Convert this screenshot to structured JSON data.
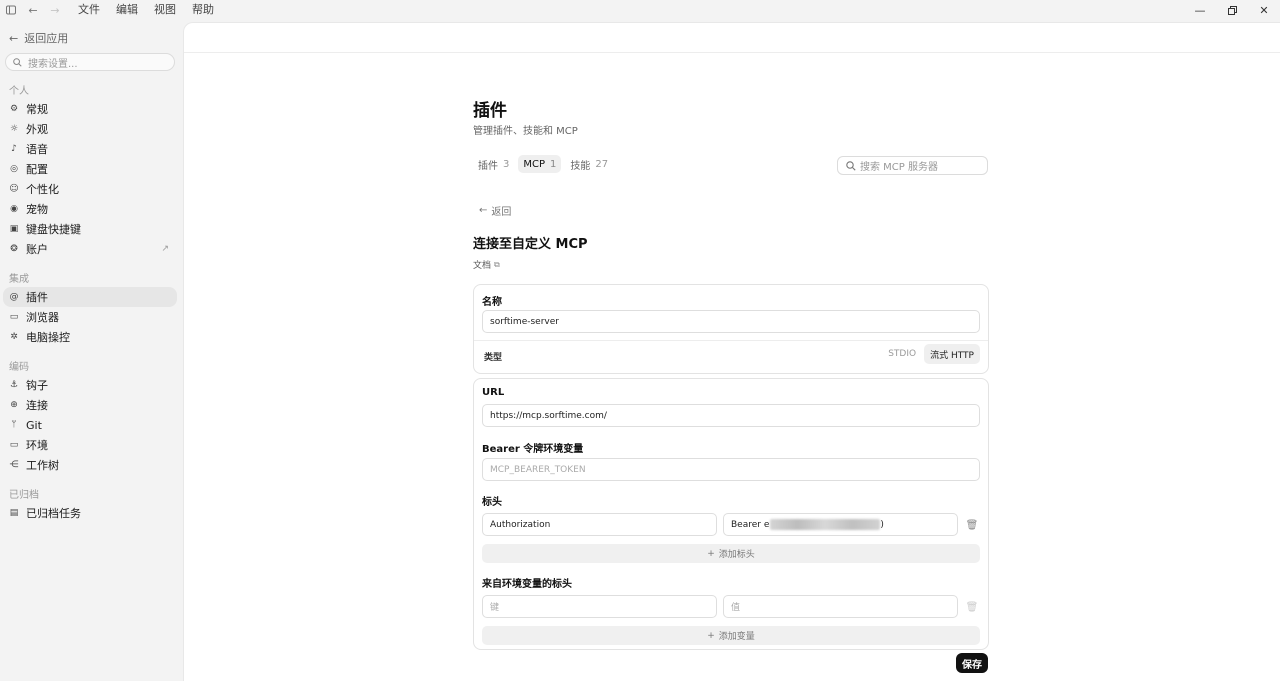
{
  "menubar": {
    "items": [
      "文件",
      "编辑",
      "视图",
      "帮助"
    ]
  },
  "sidebar": {
    "back_label": "返回应用",
    "search_placeholder": "搜索设置...",
    "sections": [
      {
        "label": "个人",
        "items": [
          {
            "label": "常规",
            "icon": "gear-icon"
          },
          {
            "label": "外观",
            "icon": "sun-icon"
          },
          {
            "label": "语音",
            "icon": "microphone-icon"
          },
          {
            "label": "配置",
            "icon": "sliders-icon"
          },
          {
            "label": "个性化",
            "icon": "smile-icon"
          },
          {
            "label": "宠物",
            "icon": "pet-icon"
          },
          {
            "label": "键盘快捷键",
            "icon": "keyboard-icon"
          },
          {
            "label": "账户",
            "icon": "account-icon",
            "external": true
          }
        ]
      },
      {
        "label": "集成",
        "items": [
          {
            "label": "插件",
            "icon": "plugin-icon",
            "active": true
          },
          {
            "label": "浏览器",
            "icon": "browser-icon"
          },
          {
            "label": "电脑操控",
            "icon": "cursor-icon"
          }
        ]
      },
      {
        "label": "编码",
        "items": [
          {
            "label": "钩子",
            "icon": "anchor-icon"
          },
          {
            "label": "连接",
            "icon": "globe-icon"
          },
          {
            "label": "Git",
            "icon": "git-branch-icon"
          },
          {
            "label": "环境",
            "icon": "monitor-icon"
          },
          {
            "label": "工作树",
            "icon": "worktree-icon"
          }
        ]
      },
      {
        "label": "已归档",
        "items": [
          {
            "label": "已归档任务",
            "icon": "archive-icon"
          }
        ]
      }
    ]
  },
  "page": {
    "title": "插件",
    "subtitle": "管理插件、技能和 MCP",
    "tabs": [
      {
        "label": "插件",
        "count": "3",
        "active": false
      },
      {
        "label": "MCP",
        "count": "1",
        "active": true
      },
      {
        "label": "技能",
        "count": "27",
        "active": false
      }
    ],
    "search_placeholder": "搜索 MCP 服务器",
    "back_label": "返回",
    "section_title": "连接至自定义 MCP",
    "doc_link": "文档"
  },
  "form": {
    "name_label": "名称",
    "name_value": "sorftime-server",
    "type_label": "类型",
    "type_options": [
      "STDIO",
      "流式 HTTP"
    ],
    "type_selected": "流式 HTTP",
    "url_label": "URL",
    "url_value": "https://mcp.sorftime.com/",
    "bearer_label": "Bearer 令牌环境变量",
    "bearer_placeholder": "MCP_BEARER_TOKEN",
    "headers_label": "标头",
    "header_key": "Authorization",
    "header_value_prefix": "Bearer e",
    "header_value_suffix": ")",
    "add_header_label": "添加标头",
    "env_headers_label": "来自环境变量的标头",
    "env_key_placeholder": "键",
    "env_value_placeholder": "值",
    "add_variable_label": "添加变量",
    "save_label": "保存"
  }
}
